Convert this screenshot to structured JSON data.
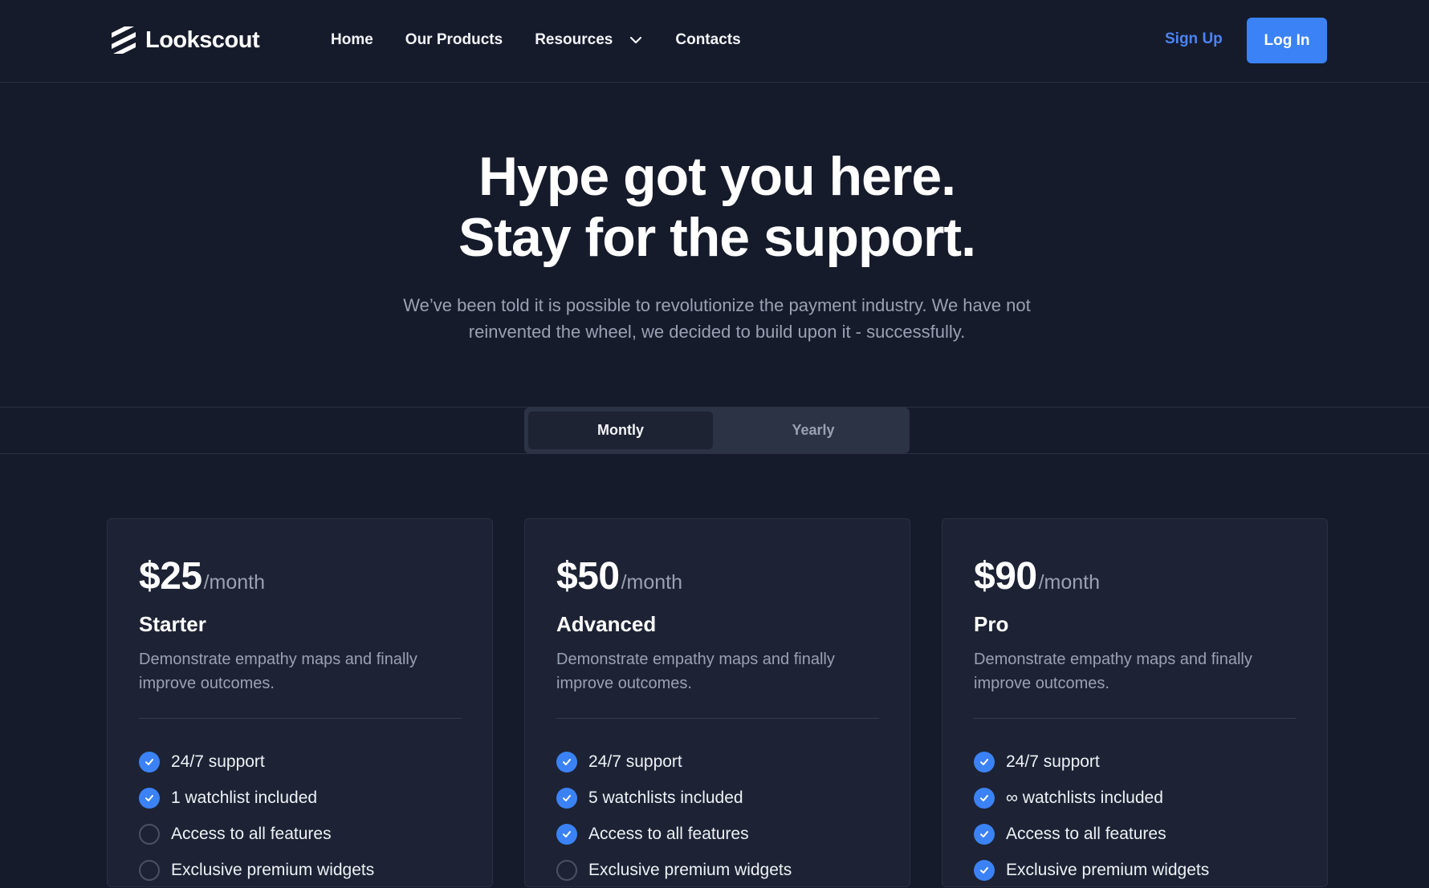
{
  "brand": {
    "name": "Lookscout",
    "icon": "stripes-logo-icon"
  },
  "nav": {
    "items": [
      {
        "label": "Home"
      },
      {
        "label": "Our Products"
      },
      {
        "label": "Resources",
        "icon": "chevron-down-icon"
      },
      {
        "label": "Contacts"
      }
    ],
    "sign_up": "Sign Up",
    "log_in": "Log In"
  },
  "hero": {
    "title_line1": "Hype got you here.",
    "title_line2": "Stay for the support.",
    "subtitle": "We’ve been told it is possible to revolutionize the payment industry. We have not reinvented the wheel, we decided to build upon it - successfully."
  },
  "billing_toggle": {
    "options": [
      {
        "label": "Montly",
        "active": true
      },
      {
        "label": "Yearly",
        "active": false
      }
    ]
  },
  "plans": [
    {
      "price": "$25",
      "period": "/month",
      "name": "Starter",
      "description": "Demonstrate empathy maps and finally improve outcomes.",
      "features": [
        {
          "text": "24/7 support",
          "included": true
        },
        {
          "text": "1 watchlist included",
          "included": true
        },
        {
          "text": "Access to all features",
          "included": false
        },
        {
          "text": "Exclusive premium widgets",
          "included": false
        }
      ]
    },
    {
      "price": "$50",
      "period": "/month",
      "name": "Advanced",
      "description": "Demonstrate empathy maps and finally improve outcomes.",
      "features": [
        {
          "text": "24/7 support",
          "included": true
        },
        {
          "text": "5 watchlists included",
          "included": true
        },
        {
          "text": "Access to all features",
          "included": true
        },
        {
          "text": "Exclusive premium widgets",
          "included": false
        }
      ]
    },
    {
      "price": "$90",
      "period": "/month",
      "name": "Pro",
      "description": "Demonstrate empathy maps and finally improve outcomes.",
      "features": [
        {
          "text": "24/7 support",
          "included": true
        },
        {
          "text": "∞ watchlists included",
          "included": true
        },
        {
          "text": "Access to all features",
          "included": true
        },
        {
          "text": "Exclusive premium widgets",
          "included": true
        }
      ]
    }
  ],
  "colors": {
    "background": "#161b2b",
    "card": "#1d2334",
    "accent": "#3b82f6",
    "muted_text": "#9aa1b2"
  }
}
